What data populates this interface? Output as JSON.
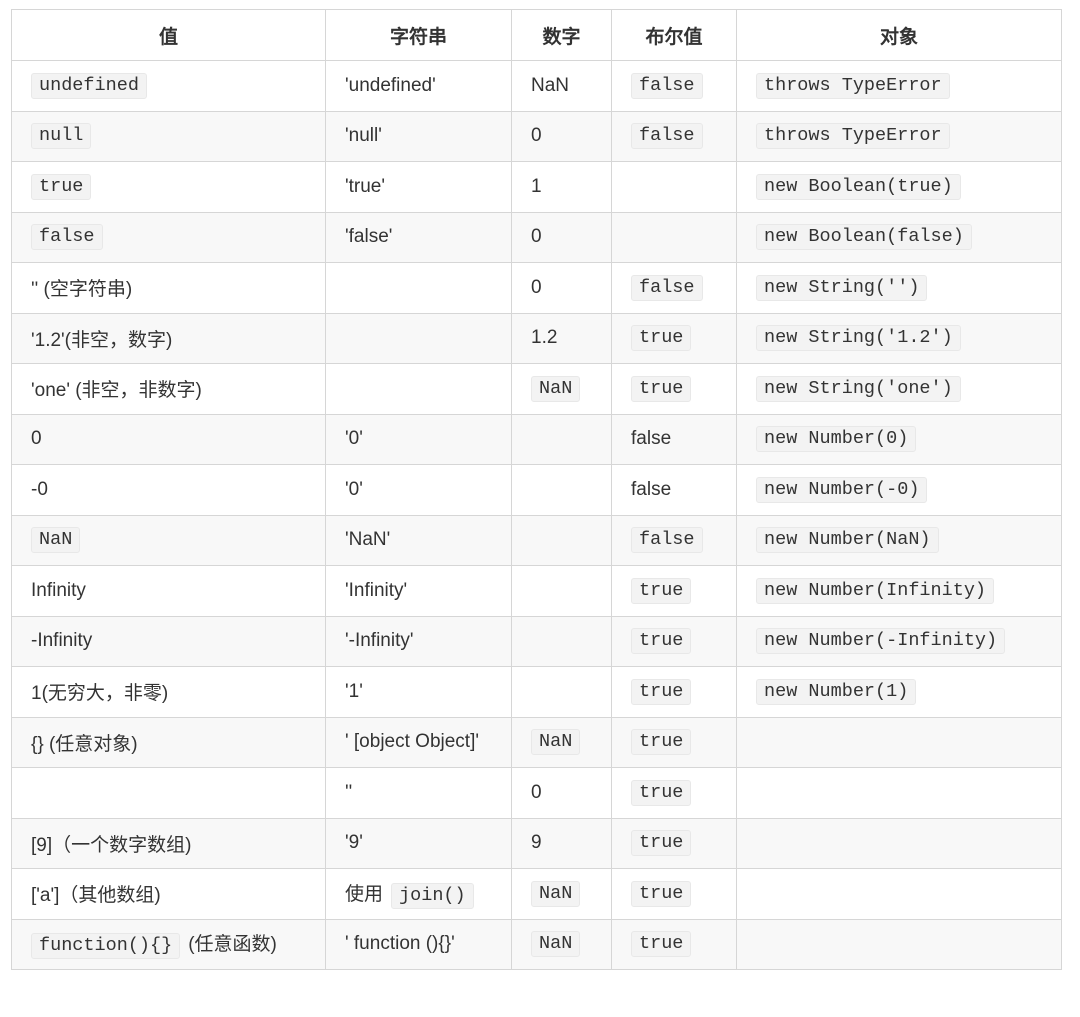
{
  "table": {
    "headers": [
      "值",
      "字符串",
      "数字",
      "布尔值",
      "对象"
    ],
    "rows": [
      [
        {
          "code": "undefined"
        },
        {
          "text": "'undefined'"
        },
        {
          "text": "NaN"
        },
        {
          "code": "false"
        },
        {
          "code": "throws TypeError"
        }
      ],
      [
        {
          "code": "null"
        },
        {
          "text": "'null'"
        },
        {
          "text": "0"
        },
        {
          "code": "false"
        },
        {
          "code": "throws TypeError"
        }
      ],
      [
        {
          "code": "true"
        },
        {
          "text": "'true'"
        },
        {
          "text": "1"
        },
        {},
        {
          "code": "new Boolean(true)"
        }
      ],
      [
        {
          "code": "false"
        },
        {
          "text": "'false'"
        },
        {
          "text": "0"
        },
        {},
        {
          "code": "new Boolean(false)"
        }
      ],
      [
        {
          "text": "'' (空字符串)"
        },
        {},
        {
          "text": "0"
        },
        {
          "code": "false"
        },
        {
          "code": "new String('')"
        }
      ],
      [
        {
          "text": "'1.2'(非空，数字)"
        },
        {},
        {
          "text": "1.2"
        },
        {
          "code": "true"
        },
        {
          "code": "new String('1.2')"
        }
      ],
      [
        {
          "text": "'one' (非空，非数字)"
        },
        {},
        {
          "code": "NaN"
        },
        {
          "code": "true"
        },
        {
          "code": "new String('one')"
        }
      ],
      [
        {
          "text": "0"
        },
        {
          "text": "'0'"
        },
        {},
        {
          "text": "false"
        },
        {
          "code": "new Number(0)"
        }
      ],
      [
        {
          "text": "-0"
        },
        {
          "text": "'0'"
        },
        {},
        {
          "text": "false"
        },
        {
          "code": "new Number(-0)"
        }
      ],
      [
        {
          "code": "NaN"
        },
        {
          "text": "'NaN'"
        },
        {},
        {
          "code": "false"
        },
        {
          "code": "new Number(NaN)"
        }
      ],
      [
        {
          "text": "Infinity"
        },
        {
          "text": "'Infinity'"
        },
        {},
        {
          "code": "true"
        },
        {
          "code": "new Number(Infinity)"
        }
      ],
      [
        {
          "text": "-Infinity"
        },
        {
          "text": "'-Infinity'"
        },
        {},
        {
          "code": "true"
        },
        {
          "code": "new Number(-Infinity)"
        }
      ],
      [
        {
          "text": "1(无穷大，非零)"
        },
        {
          "text": "'1'"
        },
        {},
        {
          "code": "true"
        },
        {
          "code": "new Number(1)"
        }
      ],
      [
        {
          "text": "{} (任意对象)"
        },
        {
          "text": "' [object Object]'"
        },
        {
          "code": "NaN"
        },
        {
          "code": "true"
        },
        {}
      ],
      [
        {},
        {
          "text": "''"
        },
        {
          "text": "0"
        },
        {
          "code": "true"
        },
        {}
      ],
      [
        {
          "text": "[9]（一个数字数组)"
        },
        {
          "text": "'9'"
        },
        {
          "text": "9"
        },
        {
          "code": "true"
        },
        {}
      ],
      [
        {
          "text": "['a']（其他数组)"
        },
        {
          "text": "使用",
          "code": "join()",
          "order": "text-first"
        },
        {
          "code": "NaN"
        },
        {
          "code": "true"
        },
        {}
      ],
      [
        {
          "code": "function(){}",
          "text": "(任意函数)",
          "order": "code-first"
        },
        {
          "text": "' function (){}'"
        },
        {
          "code": "NaN"
        },
        {
          "code": "true"
        },
        {}
      ]
    ]
  }
}
